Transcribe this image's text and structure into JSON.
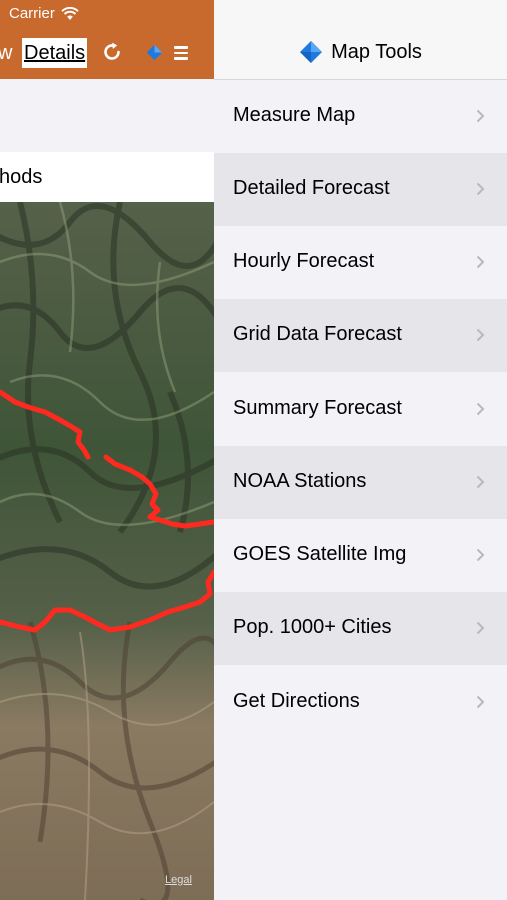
{
  "status_bar": {
    "carrier": "Carrier"
  },
  "nav": {
    "left_partial_label": "w",
    "details_label": "Details"
  },
  "main": {
    "methods_partial_text": "hods",
    "legal_label": "Legal"
  },
  "map_tools": {
    "title": "Map Tools",
    "items": [
      {
        "label": "Measure Map"
      },
      {
        "label": "Detailed Forecast"
      },
      {
        "label": "Hourly Forecast"
      },
      {
        "label": "Grid Data Forecast"
      },
      {
        "label": "Summary Forecast"
      },
      {
        "label": "NOAA Stations"
      },
      {
        "label": "GOES Satellite Img"
      },
      {
        "label": "Pop. 1000+ Cities"
      },
      {
        "label": "Get Directions"
      }
    ]
  },
  "colors": {
    "topbar": "#c8692e",
    "route_line": "#ff2a1f",
    "diamond": "#1f7ae0",
    "panel_bg": "#f2f2f7",
    "alt_row_bg": "#e5e5ea"
  }
}
